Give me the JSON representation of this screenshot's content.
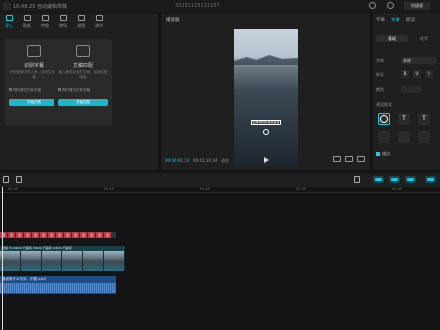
{
  "titlebar": {
    "title": "10:48:25 自动编辑草稿",
    "center": "20231103111107",
    "share_label": "快捷键"
  },
  "left_tabs": [
    {
      "label": "导入",
      "icon": "import-icon"
    },
    {
      "label": "贴纸",
      "icon": "sticker-icon"
    },
    {
      "label": "特效",
      "icon": "effects-icon"
    },
    {
      "label": "转场",
      "icon": "transition-icon"
    },
    {
      "label": "滤镜",
      "icon": "filter-icon"
    },
    {
      "label": "调节",
      "icon": "adjust-icon"
    }
  ],
  "cards": [
    {
      "title": "识别字幕",
      "desc": "识别音频中的人声，自动生成字幕",
      "option": "同时清空已有字幕",
      "button": "开始识别"
    },
    {
      "title": "文稿匹配",
      "desc": "输入音频对应的文稿，自动匹配画面",
      "option": "同时清空已有字幕",
      "button": "开始匹配"
    }
  ],
  "player": {
    "title": "播放器",
    "subtitle_text": "选择你的好物请留言",
    "time_current": "00:00:01:13",
    "time_total": "00:01:10:24",
    "ratio_label": "适应"
  },
  "inspector": {
    "tabs": [
      "字幕",
      "文本",
      "朗读"
    ],
    "active_tab": "文本",
    "subtabs": [
      "基础",
      "花字"
    ],
    "font_label": "字体",
    "font_value": "系统",
    "style_label": "样式",
    "style_buttons": [
      "B",
      "U",
      "I"
    ],
    "color_label": "颜色",
    "preset_label": "预设样式",
    "presets": [
      "T",
      "T"
    ],
    "checkbox_label": "描边"
  },
  "timeline": {
    "ruler_ticks": [
      "00:00",
      "00:10",
      "00:20",
      "00:30",
      "00:40"
    ],
    "text_clips": [
      "选",
      "选",
      "选",
      "选",
      "选",
      "选",
      "选",
      "选",
      "选",
      "选",
      "选",
      "选",
      "选",
      "选"
    ],
    "video_label": "视频  VI  VID20 已静音  VID20  已静音  VID20  已静音",
    "audio_label": "我说有什么不对 - 不要.mp3"
  },
  "colors": {
    "accent": "#24c8d8",
    "text_clip": "#b83946",
    "audio_clip": "#1c4f8a",
    "video_clip": "#2b4d55"
  }
}
